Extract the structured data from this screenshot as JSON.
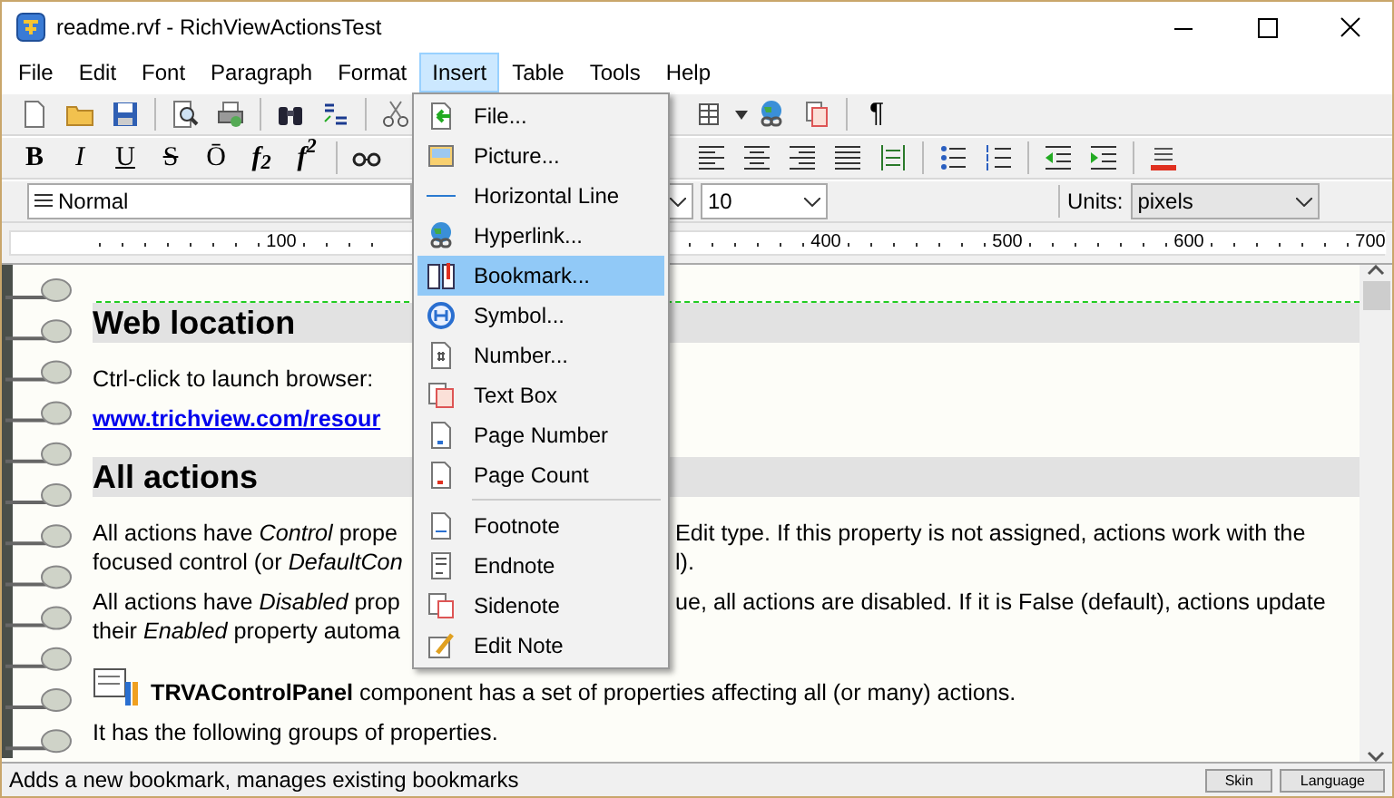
{
  "window": {
    "title": "readme.rvf - RichViewActionsTest"
  },
  "menu_bar": [
    {
      "label": "File",
      "selected": false
    },
    {
      "label": "Edit",
      "selected": false
    },
    {
      "label": "Font",
      "selected": false
    },
    {
      "label": "Paragraph",
      "selected": false
    },
    {
      "label": "Format",
      "selected": false
    },
    {
      "label": "Insert",
      "selected": true
    },
    {
      "label": "Table",
      "selected": false
    },
    {
      "label": "Tools",
      "selected": false
    },
    {
      "label": "Help",
      "selected": false
    }
  ],
  "toolbar": {
    "format_buttons": [
      "B",
      "I",
      "U",
      "S",
      "Ō",
      "f$_{2}$",
      "f$^{2}$"
    ],
    "pilcrow": "¶",
    "style_combo": {
      "value": "Normal"
    },
    "size_combo": {
      "value": "10"
    },
    "units_label": "Units:",
    "units_combo": {
      "value": "pixels"
    }
  },
  "ruler": {
    "labels": [
      "100",
      "400",
      "500",
      "600",
      "700"
    ]
  },
  "insert_menu": [
    {
      "kind": "item",
      "label": "File...",
      "selected": false
    },
    {
      "kind": "item",
      "label": "Picture...",
      "selected": false
    },
    {
      "kind": "item",
      "label": "Horizontal Line",
      "selected": false
    },
    {
      "kind": "item",
      "label": "Hyperlink...",
      "selected": false
    },
    {
      "kind": "item",
      "label": "Bookmark...",
      "selected": true
    },
    {
      "kind": "item",
      "label": "Symbol...",
      "selected": false
    },
    {
      "kind": "item",
      "label": "Number...",
      "selected": false
    },
    {
      "kind": "item",
      "label": "Text Box",
      "selected": false
    },
    {
      "kind": "item",
      "label": "Page Number",
      "selected": false
    },
    {
      "kind": "item",
      "label": "Page Count",
      "selected": false
    },
    {
      "kind": "separator"
    },
    {
      "kind": "item",
      "label": "Footnote",
      "selected": false
    },
    {
      "kind": "item",
      "label": "Endnote",
      "selected": false
    },
    {
      "kind": "item",
      "label": "Sidenote",
      "selected": false
    },
    {
      "kind": "item",
      "label": "Edit Note",
      "selected": false
    }
  ],
  "document": [
    {
      "kind": "heading",
      "left": "Web location"
    },
    {
      "kind": "text",
      "left": "Ctrl-click to launch browser:"
    },
    {
      "kind": "link",
      "left": "www.trichview.com/resour"
    },
    {
      "kind": "heading",
      "left": "All actions"
    },
    {
      "kind": "text",
      "left": "All actions have *Control* prope",
      "right": "Edit type. If this property is not assigned, actions work with the"
    },
    {
      "kind": "cont",
      "left": "focused control (or *DefaultCon*",
      "right": "l)."
    },
    {
      "kind": "text",
      "left": "All actions have *Disabled* prop",
      "right": "ue, all actions are disabled. If it is False (default), actions update"
    },
    {
      "kind": "cont",
      "left": "their *Enabled* property automa"
    },
    {
      "kind": "icon_text",
      "left": "**TRVAControlPanel** component has a set of properties affecting all (or many) actions."
    },
    {
      "kind": "text",
      "left": "It has the following groups of properties."
    }
  ],
  "status_bar": {
    "text": "Adds a new bookmark, manages existing bookmarks",
    "buttons": [
      "Skin",
      "Language"
    ]
  }
}
